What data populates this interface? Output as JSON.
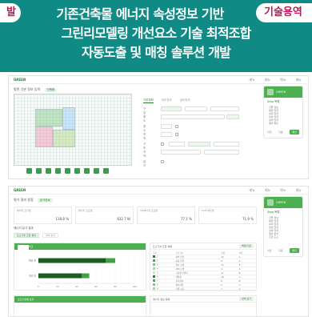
{
  "banner": {
    "left_pill": "발",
    "right_pill": "기술용역",
    "title_line1": "기존건축물 에너지 속성정보 기반",
    "title_line2": "그린리모델링 개선요소 기술 최적조합",
    "title_line3": "자동도출 및 매칭 솔루션 개발",
    "bg_color": "#0f8a84",
    "pill_text_color": "#c2185b"
  },
  "screen1": {
    "logo": "GREEN",
    "nav": [
      "메뉴",
      "메뉴",
      "메뉴",
      "메뉴"
    ],
    "section_title": "평면 기본 정보 입력",
    "section_tag": "진행중",
    "tabs": [
      "기본정보",
      "외피정보",
      "설비정보"
    ],
    "field_labels": [
      "구분",
      "용도",
      "층수",
      "면적",
      "구조",
      "지역",
      "일자"
    ],
    "card": {
      "name": "GREEN",
      "title": "Step 목록",
      "items": [
        "건물 정보",
        "평면 입력",
        "외피 입력",
        "창호 입력",
        "설비 입력",
        "결과 확인"
      ],
      "prev": "이전",
      "next": "다음",
      "go": "확인"
    }
  },
  "screen2": {
    "logo": "GREEN",
    "nav": [
      "메뉴",
      "메뉴",
      "메뉴",
      "메뉴"
    ],
    "section_title": "평가 결과 종합",
    "section_tag": "분석완료",
    "stats": [
      {
        "label": "에너지 요구량",
        "value": "118.8 %"
      },
      {
        "label": "에너지 소요량",
        "value": "632.7 W"
      },
      {
        "label": "1차에너지 소요량",
        "value": "77.1 %"
      },
      {
        "label": "CO2 배출량",
        "value": "71.9 %"
      }
    ],
    "subsection_title": "에너지 분석 결과",
    "subtabs": [
      "요소기술 조합 결과",
      "세부 분석"
    ],
    "chart_panel_title": "개선 전·후 비교",
    "chart_panel_button": "상세 보기",
    "table_panel_title": "요소기술 조합 목록",
    "table_panel_button": "엑셀 다운",
    "table_headers": [
      "구분",
      "요소기술",
      "효율",
      "비용"
    ],
    "table_rows": [
      [
        "1",
        "외벽 단열",
        "12",
        "A"
      ],
      [
        "2",
        "지붕 단열",
        "9",
        "A"
      ],
      [
        "3",
        "창호 교체",
        "15",
        "B"
      ],
      [
        "4",
        "LED 조명",
        "6",
        "A"
      ],
      [
        "5",
        "고효율 보일러",
        "11",
        "B"
      ],
      [
        "6",
        "태양광",
        "18",
        "C"
      ],
      [
        "7",
        "환기장치",
        "8",
        "B"
      ],
      [
        "8",
        "외부차양",
        "5",
        "C"
      ],
      [
        "9",
        "기밀 시공",
        "7",
        "A"
      ]
    ],
    "table_swatches": [
      "#2e7d32",
      "#4caf50",
      "#81c784",
      "#a5d6a7",
      "#c8e6c9",
      "#2e7d32",
      "#4caf50",
      "#81c784",
      "#a5d6a7"
    ],
    "chart_panel_2_title": "요소기술별 효과",
    "table_panel_2_title": "에너지 절감 목록",
    "table_panel_2_button": "상세 보기",
    "card": {
      "name": "GREEN",
      "title": "Step 목록",
      "items": [
        "건물 정보",
        "평면 입력",
        "외피 입력",
        "창호 입력",
        "설비 입력",
        "결과 분석",
        "조합 도출"
      ],
      "prev": "이전",
      "next": "다음",
      "go": "확인"
    }
  },
  "chart_data": {
    "type": "bar",
    "categories": [
      "개선 전",
      "개선 후"
    ],
    "series": [
      {
        "values": [
          70,
          45
        ]
      },
      {
        "values": [
          10,
          8
        ]
      }
    ],
    "xlim": [
      0,
      100
    ],
    "ticks": [
      "0",
      "20",
      "40",
      "60",
      "80",
      "100"
    ],
    "colors": [
      "#1b5e20",
      "#43a047",
      "#a5d6a7"
    ]
  }
}
